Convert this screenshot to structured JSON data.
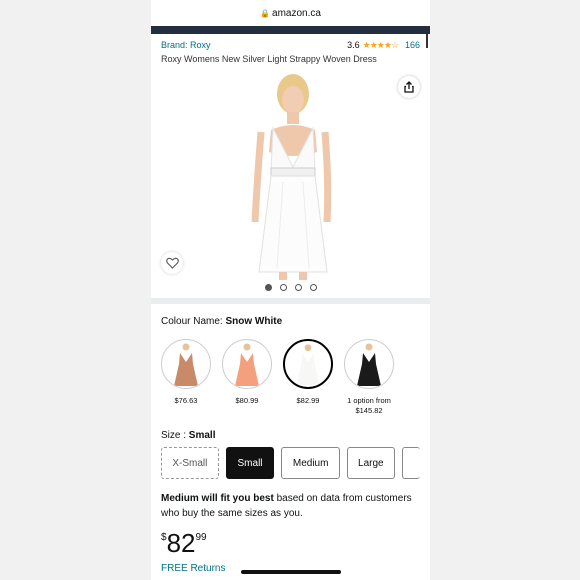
{
  "browser": {
    "url": "amazon.ca"
  },
  "product": {
    "brand": "Brand: Roxy",
    "rating": "3.6",
    "stars": "★★★★☆",
    "review_count": "166",
    "title": "Roxy Womens New Silver Light Strappy Woven Dress"
  },
  "gallery": {
    "dot_count": 4,
    "active_index": 0
  },
  "colour": {
    "label": "Colour Name:",
    "value": "Snow White",
    "options": [
      {
        "price": "$76.63",
        "color": "#c98a6a",
        "selected": false
      },
      {
        "price": "$80.99",
        "color": "#f4a07e",
        "selected": false
      },
      {
        "price": "$82.99",
        "color": "#f7f7f5",
        "selected": true
      },
      {
        "price": "1 option from",
        "price2": "$145.82",
        "color": "#1a1a1a",
        "selected": false
      }
    ]
  },
  "size": {
    "label": "Size :",
    "value": "Small",
    "options": [
      "X-Small",
      "Small",
      "Medium",
      "Large"
    ]
  },
  "fit": {
    "bold": "Medium will fit you best",
    "rest": "based on data from customers who buy the same sizes as you."
  },
  "price": {
    "currency": "$",
    "whole": "82",
    "fraction": "99"
  },
  "returns": "FREE Returns",
  "icons": {
    "share": "share-icon",
    "heart": "heart-icon",
    "lock": "lock-icon"
  }
}
